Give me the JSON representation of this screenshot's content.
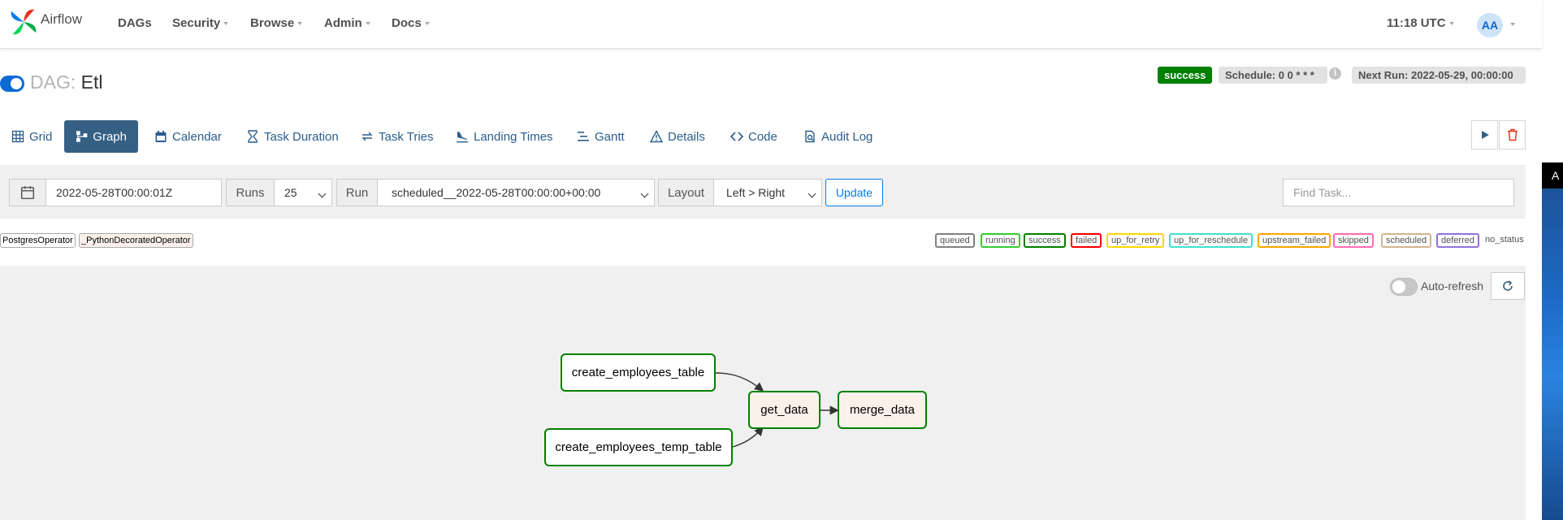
{
  "navbar": {
    "brand": "Airflow",
    "items": [
      {
        "label": "DAGs",
        "has_caret": false
      },
      {
        "label": "Security",
        "has_caret": true
      },
      {
        "label": "Browse",
        "has_caret": true
      },
      {
        "label": "Admin",
        "has_caret": true
      },
      {
        "label": "Docs",
        "has_caret": true
      }
    ],
    "time": "11:18 UTC",
    "avatar": "AA"
  },
  "dag": {
    "prefix": "DAG:",
    "name": "Etl",
    "status": "success",
    "schedule": "Schedule: 0 0 * * *",
    "info": "i",
    "next_run": "Next Run: 2022-05-29, 00:00:00"
  },
  "tabs": [
    {
      "label": "Grid",
      "icon": "grid-icon"
    },
    {
      "label": "Graph",
      "icon": "graph-icon",
      "active": true
    },
    {
      "label": "Calendar",
      "icon": "calendar-icon"
    },
    {
      "label": "Task Duration",
      "icon": "hourglass-icon"
    },
    {
      "label": "Task Tries",
      "icon": "retry-icon"
    },
    {
      "label": "Landing Times",
      "icon": "plane-landing-icon"
    },
    {
      "label": "Gantt",
      "icon": "gantt-icon"
    },
    {
      "label": "Details",
      "icon": "warning-triangle-icon"
    },
    {
      "label": "Code",
      "icon": "code-icon"
    },
    {
      "label": "Audit Log",
      "icon": "audit-log-icon"
    }
  ],
  "filters": {
    "base_date": "2022-05-28T00:00:01Z",
    "runs_label": "Runs",
    "runs_value": "25",
    "run_label": "Run",
    "run_value": "scheduled__2022-05-28T00:00:00+00:00",
    "layout_label": "Layout",
    "layout_value": "Left > Right",
    "update_label": "Update",
    "find_task_placeholder": "Find Task..."
  },
  "operators": [
    "PostgresOperator",
    "_PythonDecoratedOperator"
  ],
  "states": [
    {
      "label": "queued",
      "color": "#808080"
    },
    {
      "label": "running",
      "color": "#32cd32"
    },
    {
      "label": "success",
      "color": "#008000"
    },
    {
      "label": "failed",
      "color": "#ff0000"
    },
    {
      "label": "up_for_retry",
      "color": "#ffd700"
    },
    {
      "label": "up_for_reschedule",
      "color": "#40e0d0"
    },
    {
      "label": "upstream_failed",
      "color": "#ffa500"
    },
    {
      "label": "skipped",
      "color": "#ff69b4"
    },
    {
      "label": "scheduled",
      "color": "#d2b48c"
    },
    {
      "label": "deferred",
      "color": "#9370db"
    }
  ],
  "no_status": "no_status",
  "graph": {
    "auto_refresh_label": "Auto-refresh",
    "nodes": [
      {
        "id": "create_employees_table",
        "label": "create_employees_table",
        "operator": "PostgresOperator"
      },
      {
        "id": "create_employees_temp_table",
        "label": "create_employees_temp_table",
        "operator": "PostgresOperator"
      },
      {
        "id": "get_data",
        "label": "get_data",
        "operator": "_PythonDecoratedOperator"
      },
      {
        "id": "merge_data",
        "label": "merge_data",
        "operator": "_PythonDecoratedOperator"
      }
    ],
    "edges": [
      [
        "create_employees_table",
        "get_data"
      ],
      [
        "create_employees_temp_table",
        "get_data"
      ],
      [
        "get_data",
        "merge_data"
      ]
    ]
  },
  "colors": {
    "accent": "#017cee",
    "active_tab": "#365f84",
    "success": "#008000",
    "python_operator_fill": "#fcf1ea"
  },
  "right_edge_text": "A"
}
